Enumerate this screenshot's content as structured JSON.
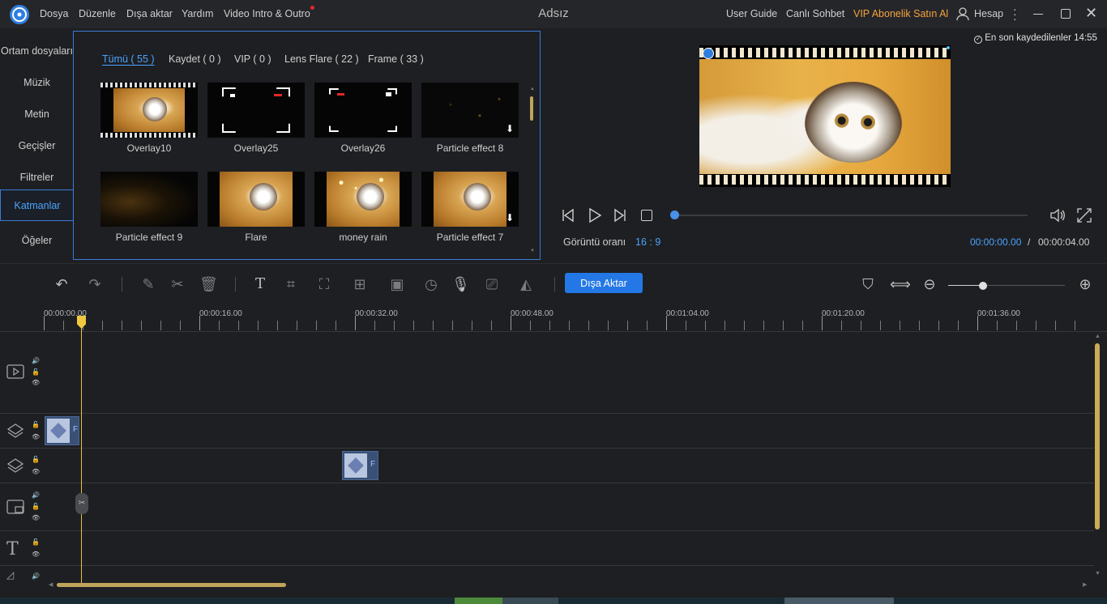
{
  "window": {
    "title": "Adsız",
    "menu": [
      "Dosya",
      "Düzenle",
      "Dışa aktar",
      "Yardım",
      "Video Intro & Outro"
    ],
    "right_links": {
      "user_guide": "User Guide",
      "live_chat": "Canlı Sohbet",
      "vip": "VIP Abonelik Satın Al",
      "account": "Hesap"
    },
    "vip_color": "#f5a43b"
  },
  "left_tabs": [
    "Ortam dosyaları",
    "Müzik",
    "Metin",
    "Geçişler",
    "Filtreler",
    "Katmanlar",
    "Öğeler"
  ],
  "active_tab": "Katmanlar",
  "categories": [
    "Tümü ( 55 )",
    "Kaydet ( 0 )",
    "VIP ( 0 )",
    "Lens Flare ( 22 )",
    "Frame ( 33 )"
  ],
  "active_category": "Tümü ( 55 )",
  "overlays": [
    {
      "name": "Overlay10",
      "style": "film-cat"
    },
    {
      "name": "Overlay25",
      "style": "rec-frame"
    },
    {
      "name": "Overlay26",
      "style": "rec-frame-small"
    },
    {
      "name": "Particle effect 8",
      "style": "particles",
      "download": true
    },
    {
      "name": "Particle effect 9",
      "style": "glow"
    },
    {
      "name": "Flare",
      "style": "cat"
    },
    {
      "name": "money rain",
      "style": "cat-sparkle"
    },
    {
      "name": "Particle effect 7",
      "style": "cat",
      "download": true
    }
  ],
  "preview": {
    "last_saved": "En son kaydedilenler 14:55",
    "aspect_label": "Görüntü oranı",
    "aspect_value": "16 : 9",
    "time_current": "00:00:00.00",
    "time_separator": "/",
    "time_total": "00:00:04.00",
    "progress": 0
  },
  "toolbar": {
    "export_label": "Dışa Aktar",
    "zoom_level": 0.3
  },
  "ruler": {
    "labels": [
      "00:00:00.00",
      "00:00:16.00",
      "00:00:32.00",
      "00:00:48.00",
      "00:01:04.00",
      "00:01:20.00",
      "00:01:36.00"
    ]
  },
  "tracks": {
    "overlay_clip_letter": "F"
  },
  "colors": {
    "accent": "#2478e6",
    "playhead": "#f0c83e"
  }
}
